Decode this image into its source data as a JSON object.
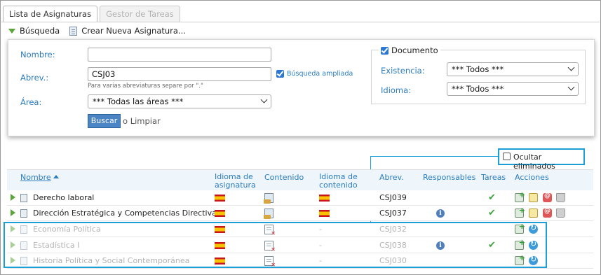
{
  "tabs": [
    {
      "label": "Lista de Asignaturas",
      "active": true
    },
    {
      "label": "Gestor de Tareas",
      "active": false
    }
  ],
  "toolbar": {
    "search_label": "Búsqueda",
    "new_label": "Crear Nueva Asignatura..."
  },
  "search": {
    "nombre_label": "Nombre:",
    "nombre_value": "",
    "abrev_label": "Abrev.:",
    "abrev_value": "CSJ03",
    "abrev_hint": "Para varias abreviaturas separe por \".\"",
    "ampliada_label": "Búsqueda ampliada",
    "ampliada_checked": true,
    "area_label": "Área:",
    "area_value": "*** Todas las áreas ***",
    "buscar_label": "Buscar",
    "limpiar_label": "o Limpiar",
    "documento_label": "Documento",
    "documento_checked": true,
    "existencia_label": "Existencia:",
    "existencia_value": "*** Todos ***",
    "idioma_label": "Idioma:",
    "idioma_value": "*** Todos ***"
  },
  "ocultar": {
    "label": "Ocultar eliminados",
    "checked": false
  },
  "table": {
    "headers": {
      "nombre": "Nombre",
      "idioma_asig_1": "Idioma de",
      "idioma_asig_2": "asignatura",
      "contenido": "Contenido",
      "idioma_cont_1": "Idioma de",
      "idioma_cont_2": "contenido",
      "abrev": "Abrev.",
      "responsables": "Responsables",
      "tareas": "Tareas",
      "acciones": "Acciones"
    },
    "rows": [
      {
        "name": "Derecho laboral",
        "idioma_cont": "",
        "abrev": "CSJ039",
        "deleted": false,
        "responsables_info": false,
        "tareas_check": true,
        "contenido_ok": true
      },
      {
        "name": "Dirección Estratégica y Competencias Directivas",
        "idioma_cont": "",
        "abrev": "CSJ037",
        "deleted": false,
        "responsables_info": true,
        "tareas_check": true,
        "contenido_ok": true
      },
      {
        "name": "Economía Política",
        "idioma_cont": "-",
        "abrev": "CSJ032",
        "deleted": true,
        "responsables_info": false,
        "tareas_check": true,
        "contenido_ok": false
      },
      {
        "name": "Estadística I",
        "idioma_cont": "-",
        "abrev": "CSJ038",
        "deleted": true,
        "responsables_info": true,
        "tareas_check": true,
        "contenido_ok": false
      },
      {
        "name": "Historia Política y Social Contemporánea",
        "idioma_cont": "-",
        "abrev": "CSJ030",
        "deleted": true,
        "responsables_info": false,
        "tareas_check": false,
        "contenido_ok": false
      }
    ]
  },
  "colors": {
    "accent": "#2b7bbf",
    "highlight": "#1a9fd9",
    "button": "#4b84c4",
    "ok": "#3aa23a"
  },
  "icons": {
    "info": "i",
    "check": "✔"
  }
}
